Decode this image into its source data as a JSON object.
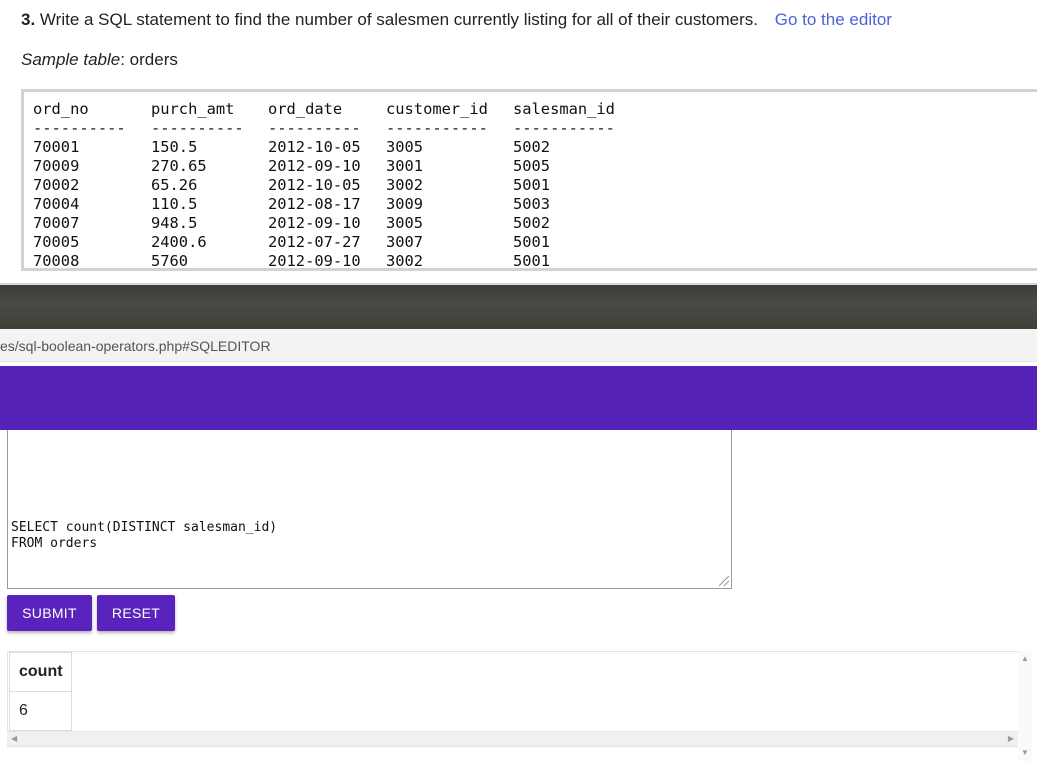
{
  "exercise": {
    "number": "3.",
    "question_text": "Write a SQL statement to find the number of salesmen currently listing for all of their customers.",
    "editor_link": "Go to the editor",
    "sample_label": "Sample table",
    "sample_name": ": orders"
  },
  "orders_table": {
    "headers": [
      "ord_no",
      "purch_amt",
      "ord_date",
      "customer_id",
      "salesman_id"
    ],
    "separators": [
      "----------",
      "----------",
      "----------",
      "-----------",
      "-----------"
    ],
    "rows": [
      [
        "70001",
        "150.5",
        "2012-10-05",
        "3005",
        "5002"
      ],
      [
        "70009",
        "270.65",
        "2012-09-10",
        "3001",
        "5005"
      ],
      [
        "70002",
        "65.26",
        "2012-10-05",
        "3002",
        "5001"
      ],
      [
        "70004",
        "110.5",
        "2012-08-17",
        "3009",
        "5003"
      ],
      [
        "70007",
        "948.5",
        "2012-09-10",
        "3005",
        "5002"
      ],
      [
        "70005",
        "2400.6",
        "2012-07-27",
        "3007",
        "5001"
      ],
      [
        "70008",
        "5760",
        "2012-09-10",
        "3002",
        "5001"
      ]
    ]
  },
  "browser": {
    "url_fragment": "es/sql-boolean-operators.php#SQLEDITOR"
  },
  "editor": {
    "code_line_1": "SELECT count(DISTINCT salesman_id)",
    "code_line_2": "FROM orders"
  },
  "buttons": {
    "submit": "SUBMIT",
    "reset": "RESET"
  },
  "result": {
    "header": "count",
    "value": "6"
  },
  "colors": {
    "accent_purple": "#5623b9",
    "link_blue": "#4a64d8",
    "titlebar_dark": "#3f3e39"
  }
}
